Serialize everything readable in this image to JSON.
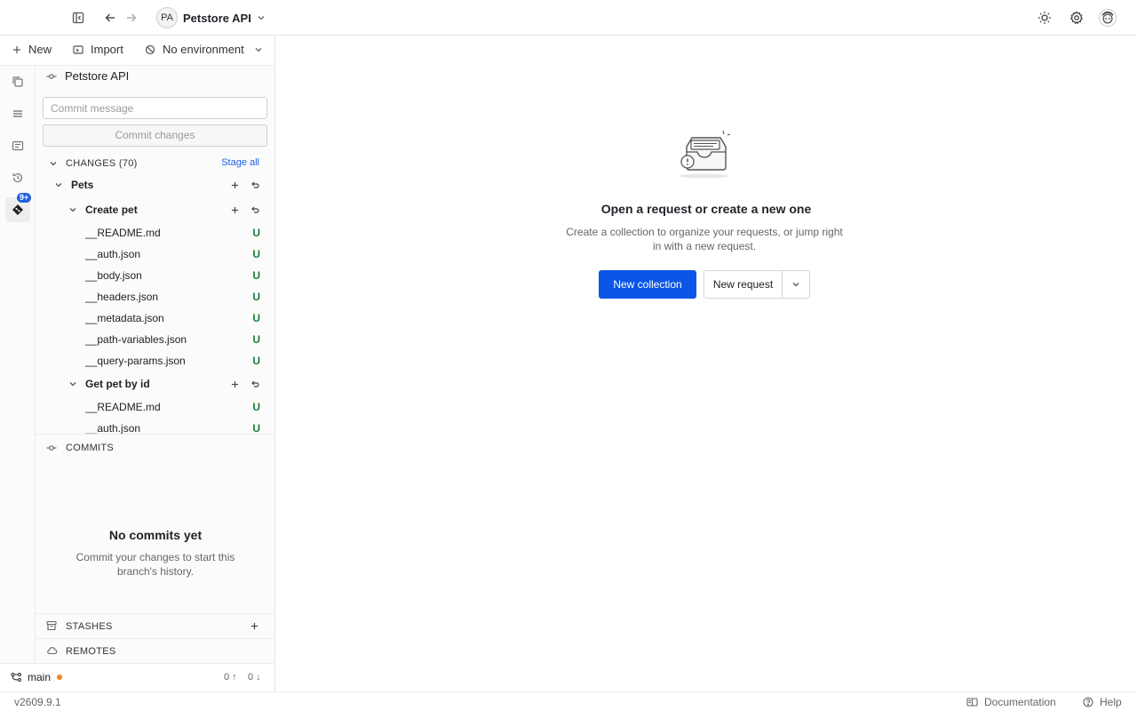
{
  "header": {
    "workspace_initials": "PA",
    "workspace_name": "Petstore API"
  },
  "toolbar": {
    "new_label": "New",
    "import_label": "Import",
    "environment_label": "No environment"
  },
  "rail": {
    "badge": "9+"
  },
  "git": {
    "project_name": "Petstore API",
    "commit_placeholder": "Commit message",
    "commit_button": "Commit changes",
    "changes_label": "CHANGES (70)",
    "stage_all": "Stage all",
    "tree": [
      {
        "type": "folder",
        "label": "Pets"
      },
      {
        "type": "folder",
        "label": "Create pet"
      },
      {
        "type": "file",
        "label": "__README.md",
        "status": "U"
      },
      {
        "type": "file",
        "label": "__auth.json",
        "status": "U"
      },
      {
        "type": "file",
        "label": "__body.json",
        "status": "U"
      },
      {
        "type": "file",
        "label": "__headers.json",
        "status": "U"
      },
      {
        "type": "file",
        "label": "__metadata.json",
        "status": "U"
      },
      {
        "type": "file",
        "label": "__path-variables.json",
        "status": "U"
      },
      {
        "type": "file",
        "label": "__query-params.json",
        "status": "U"
      },
      {
        "type": "folder",
        "label": "Get pet by id"
      },
      {
        "type": "file",
        "label": "__README.md",
        "status": "U"
      },
      {
        "type": "file",
        "label": "__auth.json",
        "status": "U"
      }
    ],
    "commits_label": "COMMITS",
    "no_commits_title": "No commits yet",
    "no_commits_desc": "Commit your changes to start this branch's history.",
    "stashes_label": "STASHES",
    "remotes_label": "REMOTES",
    "branch": "main",
    "ahead": "0",
    "behind": "0"
  },
  "empty_state": {
    "title": "Open a request or create a new one",
    "description": "Create a collection to organize your requests, or jump right in with a new request.",
    "primary_button": "New collection",
    "secondary_button": "New request"
  },
  "statusbar": {
    "version": "v2609.9.1",
    "documentation": "Documentation",
    "help": "Help"
  },
  "colors": {
    "accent": "#0a56e6",
    "link": "#1f5fe0",
    "untracked": "#1a7f37",
    "branch_dot": "#f0841a"
  }
}
